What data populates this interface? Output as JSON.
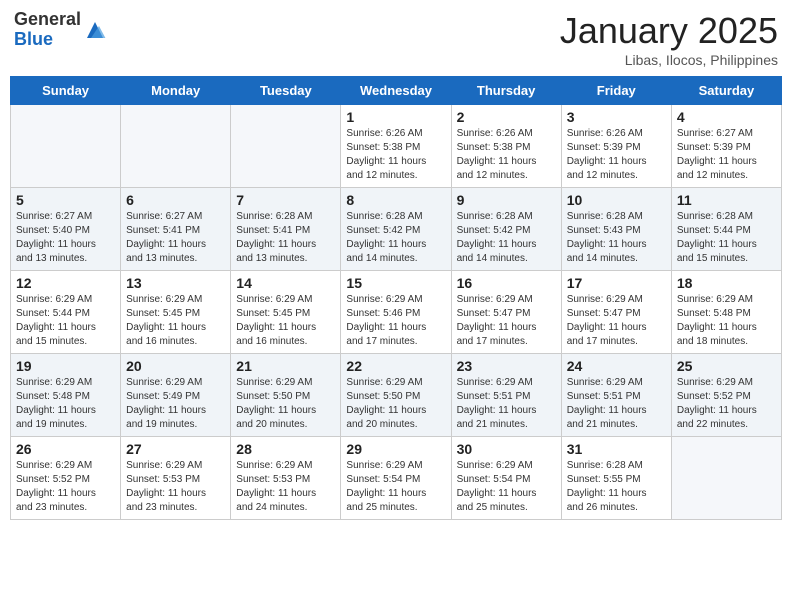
{
  "header": {
    "logo_general": "General",
    "logo_blue": "Blue",
    "month_title": "January 2025",
    "location": "Libas, Ilocos, Philippines"
  },
  "days_of_week": [
    "Sunday",
    "Monday",
    "Tuesday",
    "Wednesday",
    "Thursday",
    "Friday",
    "Saturday"
  ],
  "weeks": [
    [
      {
        "day": "",
        "info": ""
      },
      {
        "day": "",
        "info": ""
      },
      {
        "day": "",
        "info": ""
      },
      {
        "day": "1",
        "info": "Sunrise: 6:26 AM\nSunset: 5:38 PM\nDaylight: 11 hours and 12 minutes."
      },
      {
        "day": "2",
        "info": "Sunrise: 6:26 AM\nSunset: 5:38 PM\nDaylight: 11 hours and 12 minutes."
      },
      {
        "day": "3",
        "info": "Sunrise: 6:26 AM\nSunset: 5:39 PM\nDaylight: 11 hours and 12 minutes."
      },
      {
        "day": "4",
        "info": "Sunrise: 6:27 AM\nSunset: 5:39 PM\nDaylight: 11 hours and 12 minutes."
      }
    ],
    [
      {
        "day": "5",
        "info": "Sunrise: 6:27 AM\nSunset: 5:40 PM\nDaylight: 11 hours and 13 minutes."
      },
      {
        "day": "6",
        "info": "Sunrise: 6:27 AM\nSunset: 5:41 PM\nDaylight: 11 hours and 13 minutes."
      },
      {
        "day": "7",
        "info": "Sunrise: 6:28 AM\nSunset: 5:41 PM\nDaylight: 11 hours and 13 minutes."
      },
      {
        "day": "8",
        "info": "Sunrise: 6:28 AM\nSunset: 5:42 PM\nDaylight: 11 hours and 14 minutes."
      },
      {
        "day": "9",
        "info": "Sunrise: 6:28 AM\nSunset: 5:42 PM\nDaylight: 11 hours and 14 minutes."
      },
      {
        "day": "10",
        "info": "Sunrise: 6:28 AM\nSunset: 5:43 PM\nDaylight: 11 hours and 14 minutes."
      },
      {
        "day": "11",
        "info": "Sunrise: 6:28 AM\nSunset: 5:44 PM\nDaylight: 11 hours and 15 minutes."
      }
    ],
    [
      {
        "day": "12",
        "info": "Sunrise: 6:29 AM\nSunset: 5:44 PM\nDaylight: 11 hours and 15 minutes."
      },
      {
        "day": "13",
        "info": "Sunrise: 6:29 AM\nSunset: 5:45 PM\nDaylight: 11 hours and 16 minutes."
      },
      {
        "day": "14",
        "info": "Sunrise: 6:29 AM\nSunset: 5:45 PM\nDaylight: 11 hours and 16 minutes."
      },
      {
        "day": "15",
        "info": "Sunrise: 6:29 AM\nSunset: 5:46 PM\nDaylight: 11 hours and 17 minutes."
      },
      {
        "day": "16",
        "info": "Sunrise: 6:29 AM\nSunset: 5:47 PM\nDaylight: 11 hours and 17 minutes."
      },
      {
        "day": "17",
        "info": "Sunrise: 6:29 AM\nSunset: 5:47 PM\nDaylight: 11 hours and 17 minutes."
      },
      {
        "day": "18",
        "info": "Sunrise: 6:29 AM\nSunset: 5:48 PM\nDaylight: 11 hours and 18 minutes."
      }
    ],
    [
      {
        "day": "19",
        "info": "Sunrise: 6:29 AM\nSunset: 5:48 PM\nDaylight: 11 hours and 19 minutes."
      },
      {
        "day": "20",
        "info": "Sunrise: 6:29 AM\nSunset: 5:49 PM\nDaylight: 11 hours and 19 minutes."
      },
      {
        "day": "21",
        "info": "Sunrise: 6:29 AM\nSunset: 5:50 PM\nDaylight: 11 hours and 20 minutes."
      },
      {
        "day": "22",
        "info": "Sunrise: 6:29 AM\nSunset: 5:50 PM\nDaylight: 11 hours and 20 minutes."
      },
      {
        "day": "23",
        "info": "Sunrise: 6:29 AM\nSunset: 5:51 PM\nDaylight: 11 hours and 21 minutes."
      },
      {
        "day": "24",
        "info": "Sunrise: 6:29 AM\nSunset: 5:51 PM\nDaylight: 11 hours and 21 minutes."
      },
      {
        "day": "25",
        "info": "Sunrise: 6:29 AM\nSunset: 5:52 PM\nDaylight: 11 hours and 22 minutes."
      }
    ],
    [
      {
        "day": "26",
        "info": "Sunrise: 6:29 AM\nSunset: 5:52 PM\nDaylight: 11 hours and 23 minutes."
      },
      {
        "day": "27",
        "info": "Sunrise: 6:29 AM\nSunset: 5:53 PM\nDaylight: 11 hours and 23 minutes."
      },
      {
        "day": "28",
        "info": "Sunrise: 6:29 AM\nSunset: 5:53 PM\nDaylight: 11 hours and 24 minutes."
      },
      {
        "day": "29",
        "info": "Sunrise: 6:29 AM\nSunset: 5:54 PM\nDaylight: 11 hours and 25 minutes."
      },
      {
        "day": "30",
        "info": "Sunrise: 6:29 AM\nSunset: 5:54 PM\nDaylight: 11 hours and 25 minutes."
      },
      {
        "day": "31",
        "info": "Sunrise: 6:28 AM\nSunset: 5:55 PM\nDaylight: 11 hours and 26 minutes."
      },
      {
        "day": "",
        "info": ""
      }
    ]
  ]
}
